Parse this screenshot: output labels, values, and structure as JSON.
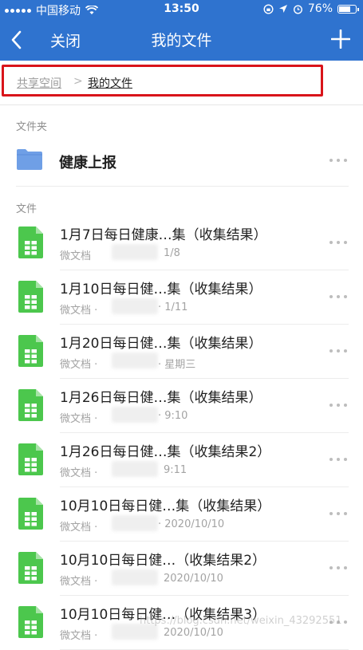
{
  "status": {
    "carrier": "中国移动",
    "time": "13:50",
    "battery": "76%",
    "battery_level": 0.76
  },
  "nav": {
    "back_icon": "chevron-left-icon",
    "close_label": "关闭",
    "title": "我的文件",
    "add_icon": "plus-icon"
  },
  "breadcrumb": {
    "items": [
      "共享空间",
      "我的文件"
    ],
    "separator": ">"
  },
  "folders_label": "文件夹",
  "folders": [
    {
      "name": "健康上报",
      "icon": "folder-icon"
    }
  ],
  "files_label": "文件",
  "files": [
    {
      "name": "1月7日每日健康…集（收集结果）",
      "type": "微文档",
      "date": "1/8"
    },
    {
      "name": "1月10日每日健…集（收集结果）",
      "type": "微文档 ·",
      "date": "· 1/11"
    },
    {
      "name": "1月20日每日健…集（收集结果）",
      "type": "微文档 ·",
      "date": "· 星期三"
    },
    {
      "name": "1月26日每日健…集（收集结果）",
      "type": "微文档 ·",
      "date": "· 9:10"
    },
    {
      "name": "1月26日每日健…集（收集结果2）",
      "type": "微文档 ·",
      "date": "9:11"
    },
    {
      "name": "10月10日每日健…集（收集结果）",
      "type": "微文档 ·",
      "date": "· 2020/10/10"
    },
    {
      "name": "10月10日每日健…（收集结果2）",
      "type": "微文档 ·",
      "date": "2020/10/10"
    },
    {
      "name": "10月10日每日健…（收集结果3）",
      "type": "微文档 ·",
      "date": "2020/10/10"
    }
  ],
  "watermark": "https://blog.csdn.net/weixin_43292551",
  "colors": {
    "header": "#2f73cf",
    "highlight": "#d9141a",
    "sheet_icon": "#4cc74d",
    "folder": "#6f9fe6"
  }
}
